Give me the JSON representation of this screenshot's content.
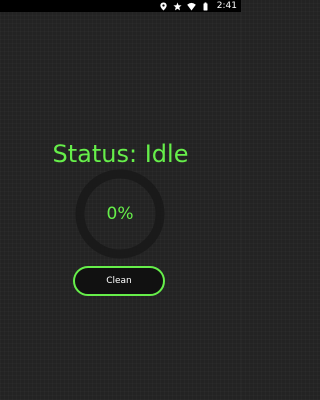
{
  "status_bar": {
    "icons": [
      "location-icon",
      "star-icon",
      "wifi-icon",
      "battery-icon"
    ],
    "time": "2:41"
  },
  "main": {
    "status_text": "Status: Idle",
    "progress_text": "0%",
    "progress_value": 0,
    "clean_label": "Clean"
  },
  "colors": {
    "background": "#232323",
    "accent": "#66ef4a",
    "ring_track": "#1a1a1a",
    "button_fill": "#111111",
    "status_bar": "#000000"
  }
}
